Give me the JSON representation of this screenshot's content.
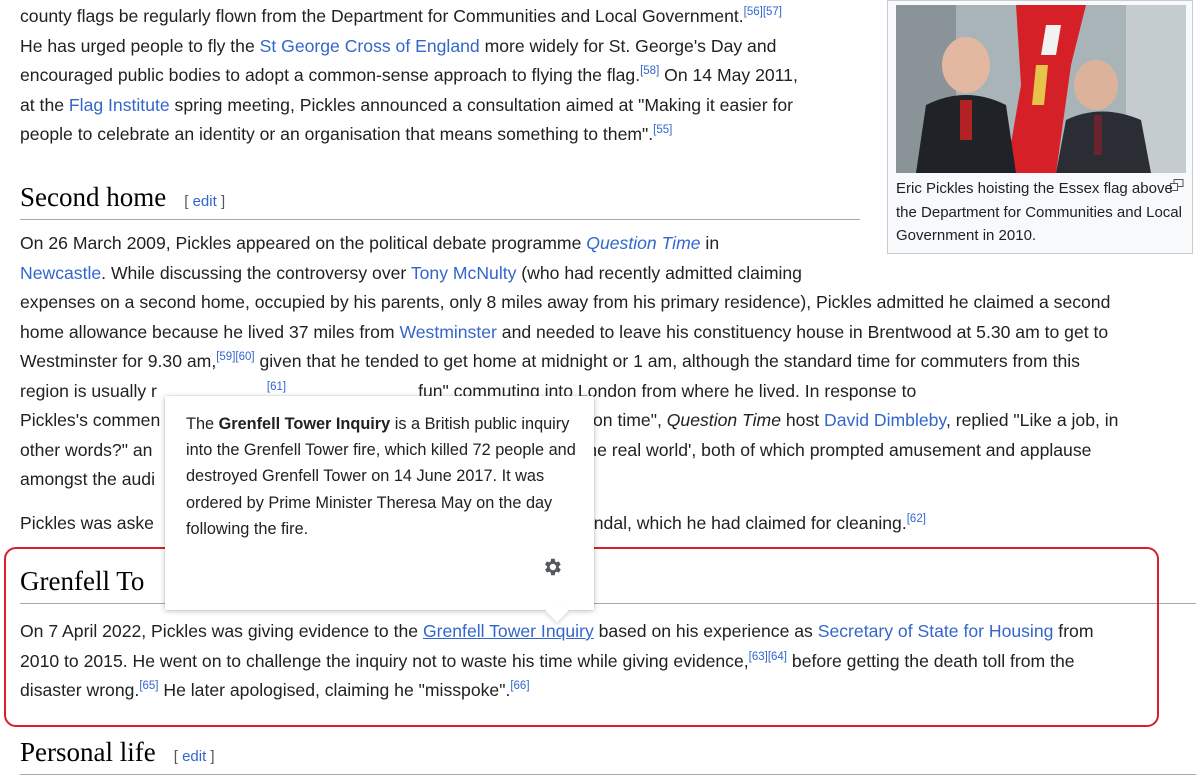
{
  "flags_section": {
    "line1_pre": "county flags be regularly flown from the Department for Communities and Local Government.",
    "line1_refs": "[56][57]",
    "line2_pre": "He has urged people to fly the ",
    "line2_link": "St George Cross of England",
    "line2_post": " more widely for St. George's Day and",
    "line3_pre": "encouraged public bodies to adopt a common-sense approach to flying the flag.",
    "line3_ref": "[58]",
    "line3_post": " On 14 May 2011,",
    "line4_pre": "at the ",
    "line4_link": "Flag Institute",
    "line4_post": " spring meeting, Pickles announced a consultation aimed at \"Making it easier for",
    "line5": "people to celebrate an identity or an organisation that means something to them\".",
    "line5_ref": "[55]"
  },
  "image_box": {
    "caption": "Eric Pickles hoisting the Essex flag above the Department for Communities and Local Government in 2010.",
    "magnify_icon": "magnify-clip-icon"
  },
  "second_home": {
    "heading": "Second home",
    "edit_open": "[",
    "edit_label": "edit",
    "edit_close": "]",
    "l1_pre": "On 26 March 2009, Pickles appeared on the political debate programme ",
    "l1_link": "Question Time",
    "l1_post": " in",
    "l2_link": "Newcastle",
    "l2_mid": ". While discussing the controversy over ",
    "l2_link2": "Tony McNulty",
    "l2_post": " (who had recently admitted claiming",
    "l3": "expenses on a second home, occupied by his parents, only 8 miles away from his primary residence), Pickles admitted he claimed a second",
    "l4_pre": "home allowance because he lived 37 miles from ",
    "l4_link": "Westminster",
    "l4_post": " and needed to leave his constituency house in Brentwood at 5.30 am to get to",
    "l5_pre": "Westminster for 9.30 am,",
    "l5_refs": "[59][60]",
    "l5_post": " given that he tended to get home at midnight or 1 am, although the standard time for commuters from this",
    "l6_pre": "region is usually r",
    "l6_ref": "[61]",
    "l6_post": "fun\" commuting into London from where he lived. In response to",
    "l7_pre": "Pickles's commen",
    "l7_mid": "] on time\", ",
    "l7_italic": "Question Time",
    "l7_mid2": " host ",
    "l7_link": "David Dimbleby",
    "l7_post": ", replied \"Like a job, in",
    "l8_pre": "other words?\" an",
    "l8_post": "the real world', both of which prompted amusement and applause",
    "l9": "amongst the audi",
    "p2_pre": "Pickles was aske",
    "p2_post": "andal, which he had claimed for cleaning.",
    "p2_ref": "[62]"
  },
  "grenfell": {
    "heading": "Grenfell To",
    "l1_pre": "On 7 April 2022, Pickles was giving evidence to the ",
    "l1_link": "Grenfell Tower Inquiry",
    "l1_mid": " based on his experience as ",
    "l1_link2": "Secretary of State for Housing",
    "l1_post": " from",
    "l2_pre": "2010 to 2015. He went on to challenge the inquiry not to waste his time while giving evidence,",
    "l2_refs": "[63][64]",
    "l2_post": " before getting the death toll from the",
    "l3_pre": "disaster wrong.",
    "l3_ref": "[65]",
    "l3_mid": " He later apologised, claiming he \"misspoke\".",
    "l3_ref2": "[66]"
  },
  "personal_life": {
    "heading": "Personal life",
    "edit_open": "[",
    "edit_label": "edit",
    "edit_close": "]"
  },
  "popup": {
    "intro": "The ",
    "bold": "Grenfell Tower Inquiry",
    "rest": " is a British public inquiry into the Grenfell Tower fire, which killed 72 people and destroyed Grenfell Tower on 14 June 2017. It was ordered by Prime Minister Theresa May on the day following the fire.",
    "settings_icon": "gear-icon"
  },
  "colors": {
    "link": "#3366cc",
    "text": "#202122",
    "highlight": "#d7202a"
  }
}
